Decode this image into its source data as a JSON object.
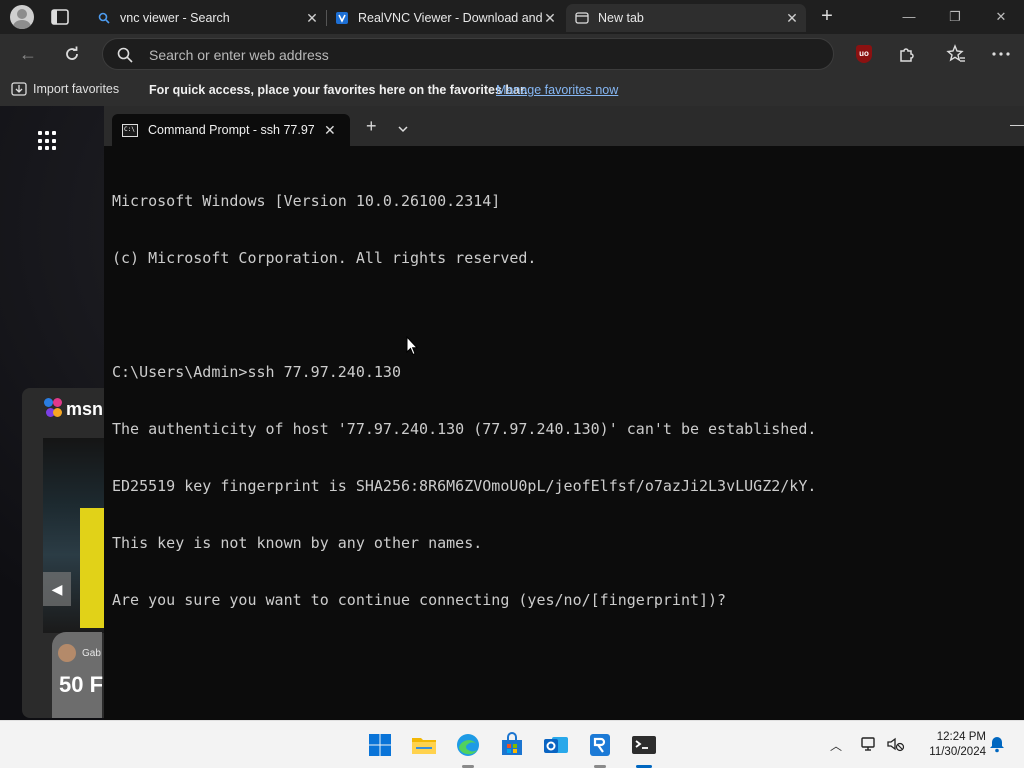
{
  "browser": {
    "tabs": [
      {
        "label": "vnc viewer - Search",
        "favicon": "search-icon"
      },
      {
        "label": "RealVNC Viewer - Download and",
        "favicon": "realvnc-icon"
      },
      {
        "label": "New tab",
        "favicon": "newtab-icon",
        "active": true
      }
    ],
    "address_placeholder": "Search or enter web address",
    "favorites": {
      "import_label": "Import favorites",
      "message": "For quick access, place your favorites here on the favorites bar.",
      "manage_link": "Manage favorites now"
    }
  },
  "background_page": {
    "msn_logo": "msn",
    "news_author": "Gab",
    "news_headline": "50 F"
  },
  "terminal": {
    "tab_title": "Command Prompt - ssh  77.97",
    "lines": [
      "Microsoft Windows [Version 10.0.26100.2314]",
      "(c) Microsoft Corporation. All rights reserved.",
      "",
      "C:\\Users\\Admin>ssh 77.97.240.130",
      "The authenticity of host '77.97.240.130 (77.97.240.130)' can't be established.",
      "ED25519 key fingerprint is SHA256:8R6M6ZVOmoU0pL/jeofElfsf/o7azJi2L3vLUGZ2/kY.",
      "This key is not known by any other names.",
      "Are you sure you want to continue connecting (yes/no/[fingerprint])?"
    ]
  },
  "taskbar": {
    "time": "12:24 PM",
    "date": "11/30/2024"
  },
  "colors": {
    "accent": "#0067c0",
    "terminal_bg": "#0c0c0c",
    "terminal_text": "#cccccc",
    "link": "#86b7f4"
  }
}
